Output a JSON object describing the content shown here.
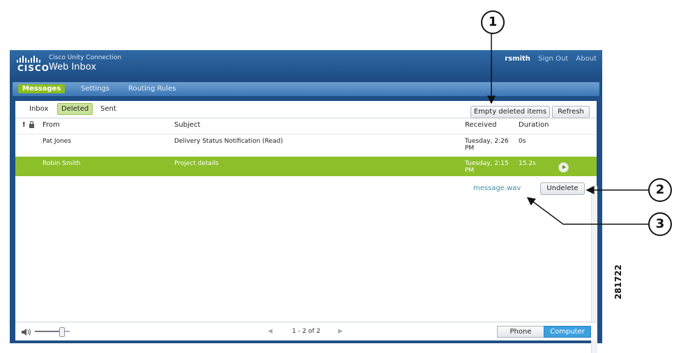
{
  "app": {
    "brand_line": "Cisco Unity Connection",
    "title": "Web Inbox",
    "logo_text": "CISCO"
  },
  "topbar": {
    "username": "rsmith",
    "sign_out": "Sign Out",
    "about": "About"
  },
  "nav": {
    "messages": "Messages",
    "settings": "Settings",
    "routing_rules": "Routing Rules"
  },
  "folders": {
    "inbox": "Inbox",
    "deleted": "Deleted",
    "sent": "Sent"
  },
  "toolbar": {
    "empty_deleted": "Empty deleted items",
    "refresh": "Refresh"
  },
  "columns": {
    "priority_glyph": "!",
    "from": "From",
    "subject": "Subject",
    "received": "Received",
    "duration": "Duration"
  },
  "messages": [
    {
      "from": "Pat Jones",
      "subject": "Delivery Status Notification (Read)",
      "received_line1": "Tuesday, 2:26",
      "received_line2": "PM",
      "duration": "0s",
      "selected": false
    },
    {
      "from": "Robin Smith",
      "subject": "Project details",
      "received_line1": "Tuesday, 2:15",
      "received_line2": "PM",
      "duration": "15.2s",
      "selected": true
    }
  ],
  "detail": {
    "attachment": "message.wav",
    "undelete": "Undelete"
  },
  "footer": {
    "page_range": "1 - 2 of 2",
    "phone": "Phone",
    "computer": "Computer",
    "volume_level": 0.75
  },
  "figure": {
    "callouts": [
      "1",
      "2",
      "3"
    ],
    "figure_number": "281722"
  },
  "colors": {
    "accent_green": "#8cbf2a",
    "header_blue": "#1f4f86",
    "link_teal": "#3d8fa4"
  }
}
